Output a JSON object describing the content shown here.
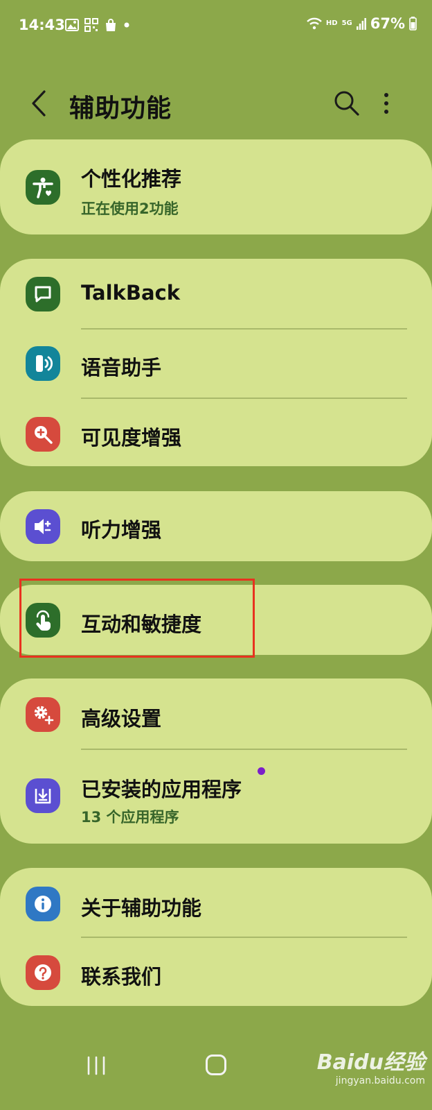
{
  "status_bar": {
    "time": "14:43",
    "left_icons": [
      "gallery-icon",
      "qr-icon",
      "shopping-bag-icon",
      "dot"
    ],
    "network": {
      "hd": "HD",
      "gen": "5G"
    },
    "battery": "67%"
  },
  "header": {
    "title": "辅助功能",
    "icons": [
      "back-icon",
      "search-icon",
      "more-vert-icon"
    ]
  },
  "groups": [
    {
      "items": [
        {
          "label": "个性化推荐",
          "subtitle": "正在使用2功能",
          "icon": "accessibility-person-icon",
          "color": "#2d6e2a"
        }
      ]
    },
    {
      "items": [
        {
          "label": "TalkBack",
          "icon": "chat-square-icon",
          "color": "#2d6e2a"
        },
        {
          "label": "语音助手",
          "icon": "voice-assistant-icon",
          "color": "#12859a"
        },
        {
          "label": "可见度增强",
          "icon": "zoom-in-icon",
          "color": "#d64a3d"
        }
      ]
    },
    {
      "items": [
        {
          "label": "听力增强",
          "icon": "volume-plus-icon",
          "color": "#5b4fd1"
        }
      ]
    },
    {
      "items": [
        {
          "label": "互动和敏捷度",
          "icon": "touch-hand-icon",
          "color": "#2d6e2a"
        }
      ]
    },
    {
      "items": [
        {
          "label": "高级设置",
          "icon": "gear-plus-icon",
          "color": "#d64a3d"
        },
        {
          "label": "已安装的应用程序",
          "subtitle": "13 个应用程序",
          "icon": "download-box-icon",
          "color": "#5b4fd1"
        }
      ]
    },
    {
      "items": [
        {
          "label": "关于辅助功能",
          "icon": "info-icon",
          "color": "#2f78c4"
        },
        {
          "label": "联系我们",
          "icon": "help-icon",
          "color": "#d64a3d"
        }
      ]
    }
  ],
  "watermark": {
    "main": "Baidu经验",
    "sub": "jingyan.baidu.com"
  },
  "colors": {
    "background": "#8ca84a",
    "card": "#d5e38f",
    "highlight": "#e8321f",
    "subtitle": "#37652a"
  }
}
